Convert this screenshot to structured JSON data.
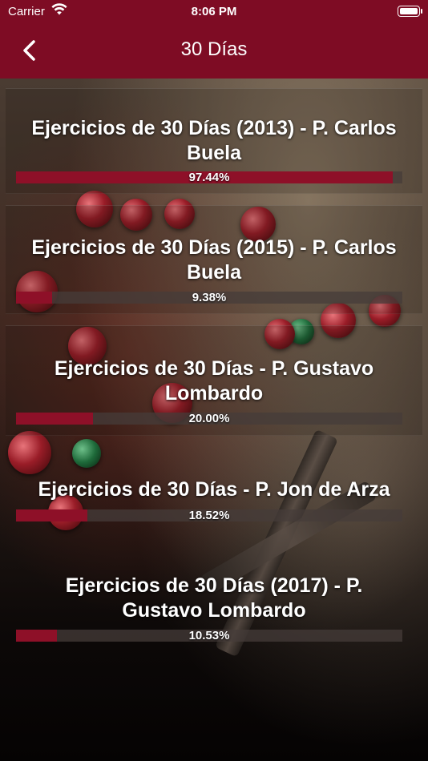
{
  "status_bar": {
    "carrier": "Carrier",
    "time": "8:06 PM"
  },
  "nav": {
    "title": "30 Días",
    "back_icon": "chevron-left-icon"
  },
  "colors": {
    "brand": "#7e0c24",
    "progress_fill": "#8e1028",
    "progress_track": "#46403a"
  },
  "items": [
    {
      "title": "Ejercicios de 30 Días (2013) - P. Carlos Buela",
      "progress_label": "97.44%",
      "progress": 0.9744
    },
    {
      "title": "Ejercicios de 30 Días (2015) - P. Carlos Buela",
      "progress_label": "9.38%",
      "progress": 0.0938
    },
    {
      "title": "Ejercicios de 30 Días - P. Gustavo Lombardo",
      "progress_label": "20.00%",
      "progress": 0.2
    },
    {
      "title": "Ejercicios de 30 Días - P. Jon de Arza",
      "progress_label": "18.52%",
      "progress": 0.1852
    },
    {
      "title": "Ejercicios de 30 Días (2017) - P. Gustavo Lombardo",
      "progress_label": "10.53%",
      "progress": 0.1053
    }
  ]
}
